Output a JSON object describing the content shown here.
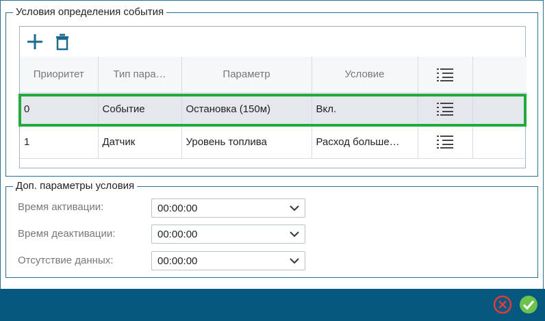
{
  "groups": {
    "conditions_title": "Условия определения события",
    "extra_title": "Доп. параметры условия"
  },
  "toolbar": {
    "add_icon": "plus-icon",
    "delete_icon": "trash-icon"
  },
  "table": {
    "headers": [
      "Приоритет",
      "Тип пара…",
      "Параметр",
      "Условие",
      "",
      ""
    ],
    "rows": [
      {
        "priority": "0",
        "type": "Событие",
        "param": "Остановка (150м)",
        "condition": "Вкл."
      },
      {
        "priority": "1",
        "type": "Датчик",
        "param": "Уровень топлива",
        "condition": "Расход больше…"
      }
    ],
    "selected_row": 0
  },
  "extra": {
    "activation_label": "Время активации:",
    "activation_value": "00:00:00",
    "deactivation_label": "Время деактивации:",
    "deactivation_value": "00:00:00",
    "nodata_label": "Отсутствие данных:",
    "nodata_value": "00:00:00"
  },
  "colors": {
    "accent": "#2a6f8f",
    "footer": "#06587f",
    "selection": "#22aa3c",
    "cancel": "#e33b3b",
    "ok": "#6cc24a"
  }
}
